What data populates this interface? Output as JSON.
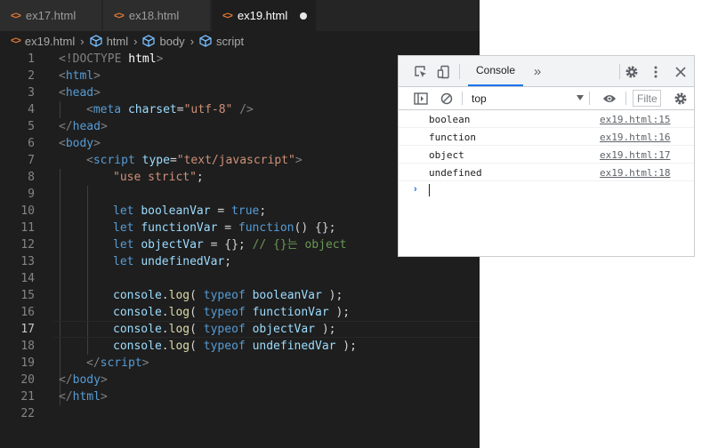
{
  "editor": {
    "tabs": [
      {
        "icon": "<>",
        "label": "ex17.html"
      },
      {
        "icon": "<>",
        "label": "ex18.html"
      },
      {
        "icon": "<>",
        "label": "ex19.html",
        "dirty": true
      }
    ],
    "breadcrumb": {
      "file": "ex19.html",
      "items": [
        "html",
        "body",
        "script"
      ]
    },
    "line_numbers": [
      "1",
      "2",
      "3",
      "4",
      "5",
      "6",
      "7",
      "8",
      "9",
      "10",
      "11",
      "12",
      "13",
      "14",
      "15",
      "16",
      "17",
      "18",
      "19",
      "20",
      "21",
      "22"
    ],
    "code": {
      "l1_a": "<!DOCTYPE ",
      "l1_b": "html",
      "l1_c": ">",
      "l2_a": "<",
      "l2_b": "html",
      "l2_c": ">",
      "l3_a": "<",
      "l3_b": "head",
      "l3_c": ">",
      "l4_a": "<",
      "l4_b": "meta",
      "l4_c": " ",
      "l4_d": "charset",
      "l4_e": "=",
      "l4_f": "\"utf-8\"",
      "l4_g": " />",
      "l5_a": "</",
      "l5_b": "head",
      "l5_c": ">",
      "l6_a": "<",
      "l6_b": "body",
      "l6_c": ">",
      "l7_a": "<",
      "l7_b": "script",
      "l7_c": " ",
      "l7_d": "type",
      "l7_e": "=",
      "l7_f": "\"text/javascript\"",
      "l7_g": ">",
      "l8_a": "\"use strict\"",
      "l8_b": ";",
      "l10_a": "let",
      "l10_b": " ",
      "l10_c": "booleanVar",
      "l10_d": " = ",
      "l10_e": "true",
      "l10_f": ";",
      "l11_a": "let",
      "l11_b": " ",
      "l11_c": "functionVar",
      "l11_d": " = ",
      "l11_e": "function",
      "l11_f": "() {};",
      "l12_a": "let",
      "l12_b": " ",
      "l12_c": "objectVar",
      "l12_d": " = {}; ",
      "l12_e": "// {}는 object",
      "l13_a": "let",
      "l13_b": " ",
      "l13_c": "undefinedVar",
      "l13_d": ";",
      "l15_a": "console",
      "l15_b": ".",
      "l15_c": "log",
      "l15_d": "( ",
      "l15_e": "typeof",
      "l15_f": " ",
      "l15_g": "booleanVar",
      "l15_h": " );",
      "l16_a": "console",
      "l16_b": ".",
      "l16_c": "log",
      "l16_d": "( ",
      "l16_e": "typeof",
      "l16_f": " ",
      "l16_g": "functionVar",
      "l16_h": " );",
      "l17_a": "console",
      "l17_b": ".",
      "l17_c": "log",
      "l17_d": "( ",
      "l17_e": "typeof",
      "l17_f": " ",
      "l17_g": "objectVar",
      "l17_h": " );",
      "l18_a": "console",
      "l18_b": ".",
      "l18_c": "log",
      "l18_d": "( ",
      "l18_e": "typeof",
      "l18_f": " ",
      "l18_g": "undefinedVar",
      "l18_h": " );",
      "l19_a": "</",
      "l19_b": "script",
      "l19_c": ">",
      "l20_a": "</",
      "l20_b": "body",
      "l20_c": ">",
      "l21_a": "</",
      "l21_b": "html",
      "l21_c": ">"
    }
  },
  "devtools": {
    "tab_label": "Console",
    "more_tabs": "»",
    "context": "top",
    "filter_placeholder": "Filte",
    "logs": [
      {
        "message": "boolean",
        "source": "ex19.html:15"
      },
      {
        "message": "function",
        "source": "ex19.html:16"
      },
      {
        "message": "object",
        "source": "ex19.html:17"
      },
      {
        "message": "undefined",
        "source": "ex19.html:18"
      }
    ],
    "prompt": "›"
  },
  "colors": {
    "editor_bg": "#1e1e1e",
    "tag": "#569cd6",
    "attribute": "#9cdcfe",
    "string": "#ce9178",
    "function": "#dcdcaa",
    "comment": "#6a9955",
    "devtools_accent": "#1a73e8"
  }
}
